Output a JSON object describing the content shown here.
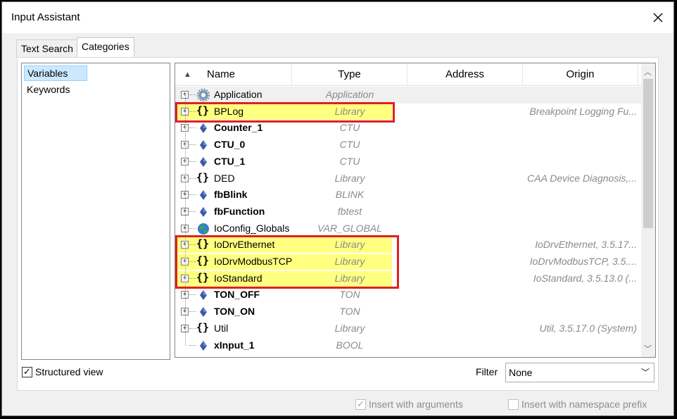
{
  "window": {
    "title": "Input Assistant"
  },
  "tabs": [
    {
      "label": "Text Search"
    },
    {
      "label": "Categories"
    }
  ],
  "categories": [
    {
      "label": "Variables"
    },
    {
      "label": "Keywords"
    }
  ],
  "columns": [
    {
      "label": "Name"
    },
    {
      "label": "Type"
    },
    {
      "label": "Address"
    },
    {
      "label": "Origin"
    }
  ],
  "rows": [
    {
      "name": "Application",
      "type": "Application",
      "origin": "",
      "icon": "gear-icon",
      "bold": false
    },
    {
      "name": "BPLog",
      "type": "Library",
      "origin": "Breakpoint Logging Fu...",
      "icon": "braces-icon",
      "bold": false
    },
    {
      "name": "Counter_1",
      "type": "CTU",
      "origin": "",
      "icon": "instance-icon",
      "bold": true
    },
    {
      "name": "CTU_0",
      "type": "CTU",
      "origin": "",
      "icon": "instance-icon",
      "bold": true
    },
    {
      "name": "CTU_1",
      "type": "CTU",
      "origin": "",
      "icon": "instance-icon",
      "bold": true
    },
    {
      "name": "DED",
      "type": "Library",
      "origin": "CAA Device Diagnosis,...",
      "icon": "braces-icon",
      "bold": false
    },
    {
      "name": "fbBlink",
      "type": "BLINK",
      "origin": "",
      "icon": "instance-icon",
      "bold": true
    },
    {
      "name": "fbFunction",
      "type": "fbtest",
      "origin": "",
      "icon": "instance-icon",
      "bold": true
    },
    {
      "name": "IoConfig_Globals",
      "type": "VAR_GLOBAL",
      "origin": "",
      "icon": "globe-icon",
      "bold": false
    },
    {
      "name": "IoDrvEthernet",
      "type": "Library",
      "origin": "IoDrvEthernet, 3.5.17...",
      "icon": "braces-icon",
      "bold": false
    },
    {
      "name": "IoDrvModbusTCP",
      "type": "Library",
      "origin": "IoDrvModbusTCP, 3.5....",
      "icon": "braces-icon",
      "bold": false
    },
    {
      "name": "IoStandard",
      "type": "Library",
      "origin": "IoStandard, 3.5.13.0 (...",
      "icon": "braces-icon",
      "bold": false
    },
    {
      "name": "TON_OFF",
      "type": "TON",
      "origin": "",
      "icon": "instance-icon",
      "bold": true
    },
    {
      "name": "TON_ON",
      "type": "TON",
      "origin": "",
      "icon": "instance-icon",
      "bold": true
    },
    {
      "name": "Util",
      "type": "Library",
      "origin": "Util, 3.5.17.0 (System)",
      "icon": "braces-icon",
      "bold": false
    },
    {
      "name": "xInput_1",
      "type": "BOOL",
      "origin": "",
      "icon": "instance-icon",
      "bold": true
    }
  ],
  "structured_view": {
    "label": "Structured view",
    "checked": true
  },
  "filter": {
    "label": "Filter",
    "value": "None"
  },
  "insert_with_arguments": {
    "label": "Insert with arguments",
    "checked": true,
    "enabled": false
  },
  "insert_with_namespace": {
    "label": "Insert with namespace prefix",
    "checked": false,
    "enabled": false
  },
  "colors": {
    "highlight": "#ffff80",
    "box": "#e02020",
    "selection": "#cce8ff"
  }
}
